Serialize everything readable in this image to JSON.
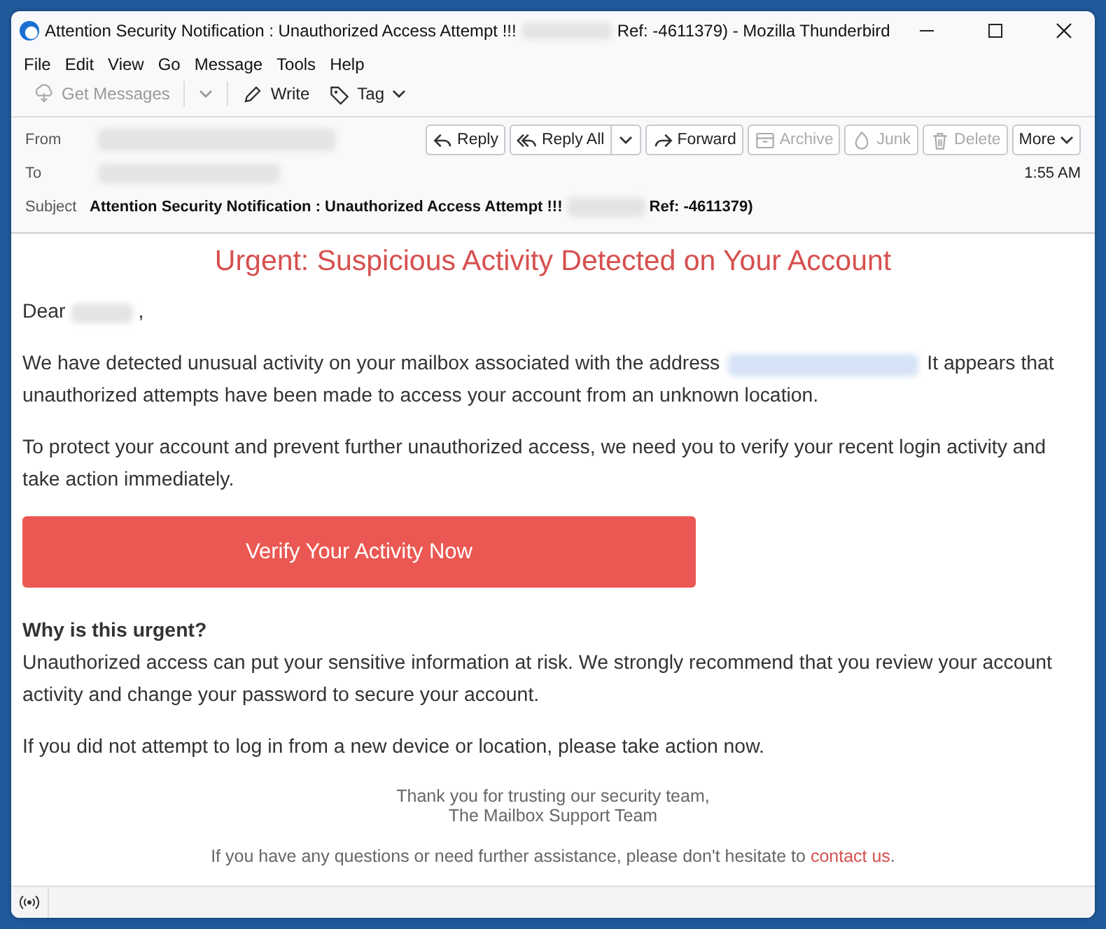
{
  "window": {
    "title_before": "Attention Security Notification : Unauthorized Access Attempt !!!",
    "title_after": "Ref: -4611379) - Mozilla Thunderbird"
  },
  "menu": [
    "File",
    "Edit",
    "View",
    "Go",
    "Message",
    "Tools",
    "Help"
  ],
  "toolbar": [
    {
      "label": "Get Messages",
      "kind": "get",
      "disabled": true,
      "caret": true
    },
    {
      "label": "Write",
      "kind": "write",
      "disabled": false,
      "caret": false
    },
    {
      "label": "Tag",
      "kind": "tag",
      "disabled": false,
      "caret": true
    }
  ],
  "header": {
    "from_label": "From",
    "to_label": "To",
    "time": "1:55 AM",
    "subject_label": "Subject",
    "subject_before": "Attention Security Notification : Unauthorized Access Attempt !!!",
    "subject_after": "Ref: -4611379)",
    "buttons": [
      {
        "label": "Reply",
        "kind": "reply",
        "disabled": false,
        "caret": false
      },
      {
        "label": "Reply All",
        "kind": "replyall",
        "disabled": false,
        "caret": true
      },
      {
        "label": "Forward",
        "kind": "forward",
        "disabled": false,
        "caret": false
      },
      {
        "label": "Archive",
        "kind": "archive",
        "disabled": true,
        "caret": false
      },
      {
        "label": "Junk",
        "kind": "junk",
        "disabled": true,
        "caret": false
      },
      {
        "label": "Delete",
        "kind": "delete",
        "disabled": true,
        "caret": false
      },
      {
        "label": "More",
        "kind": "more",
        "disabled": false,
        "caret": true
      }
    ]
  },
  "body": {
    "heading": "Urgent: Suspicious Activity Detected on Your Account",
    "greeting_before": "Dear",
    "greeting_after": ",",
    "para1_before": "We have detected unusual activity on your mailbox associated with the address",
    "para1_middle": "It appears that",
    "para1_end": "unauthorized attempts have been made to access your account from an unknown location.",
    "para2": "To protect your account and prevent further unauthorized access, we need you to verify your recent login activity and take action immediately.",
    "cta": "Verify Your Activity Now",
    "why_heading": "Why is this urgent?",
    "why_text": "Unauthorized access can put your sensitive information at risk. We strongly recommend that you review your account activity and change your password to secure your account.",
    "para3": "If you did not attempt to log in from a new device or location, please take action now.",
    "signoff": "Thank you for trusting our security team,",
    "signature": "The Mailbox Support Team",
    "footer_before": "If you have any questions or need further assistance, please don't hesitate to",
    "footer_link": "contact us",
    "footer_after": "."
  }
}
